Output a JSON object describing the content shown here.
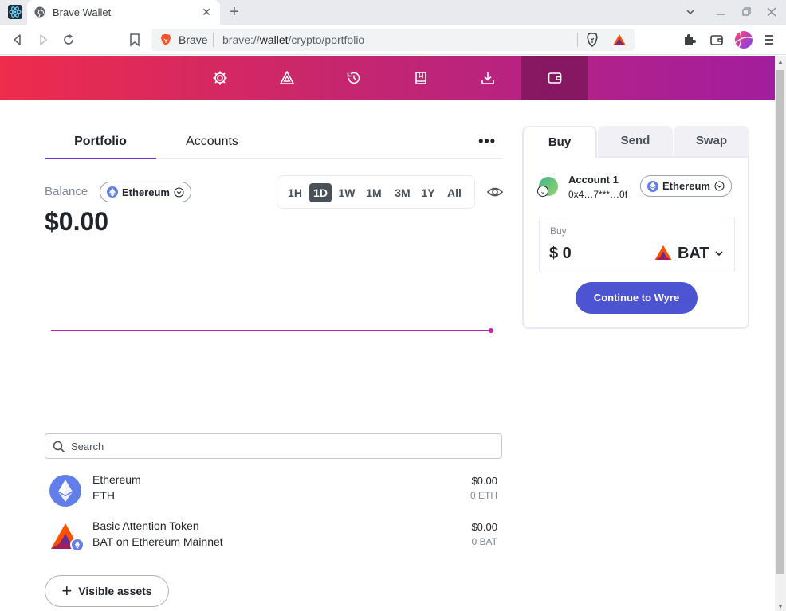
{
  "browser": {
    "tab_title": "Brave Wallet",
    "omnibox_site": "Brave",
    "url_prefix": "brave://",
    "url_host": "wallet",
    "url_path": "/crypto/portfolio"
  },
  "wallet_nav": {
    "items": [
      "gear-icon",
      "bat-icon",
      "history-icon",
      "book-icon",
      "download-icon",
      "wallet-icon"
    ],
    "active_item": "wallet-icon"
  },
  "portfolio": {
    "tabs": [
      "Portfolio",
      "Accounts"
    ],
    "active_tab": "Portfolio",
    "more_label": "•••",
    "balance_label": "Balance",
    "network": "Ethereum",
    "balance_value": "$0.00",
    "timeframes": [
      "1H",
      "1D",
      "1W",
      "1M",
      "3M",
      "1Y",
      "All"
    ],
    "active_timeframe": "1D",
    "search_placeholder": "Search",
    "assets": [
      {
        "name": "Ethereum",
        "sub": "ETH",
        "fiat": "$0.00",
        "qty": "0 ETH",
        "icon": "ethereum-icon"
      },
      {
        "name": "Basic Attention Token",
        "sub": "BAT on Ethereum Mainnet",
        "fiat": "$0.00",
        "qty": "0 BAT",
        "icon": "bat-token-icon"
      }
    ],
    "visible_assets_label": "Visible assets"
  },
  "buy_panel": {
    "tabs": [
      "Buy",
      "Send",
      "Swap"
    ],
    "active_tab": "Buy",
    "account_name": "Account 1",
    "account_address": "0x4…7***…0f",
    "network": "Ethereum",
    "buy_label": "Buy",
    "amount": "$ 0",
    "token": "BAT",
    "continue_label": "Continue to Wyre"
  },
  "colors": {
    "header_gradient_start": "#ee2c4c",
    "header_gradient_end": "#a21e9e",
    "chart_line": "#c11fb0",
    "tab_underline": "#7a2dd6",
    "primary_button": "#4c54d2"
  }
}
